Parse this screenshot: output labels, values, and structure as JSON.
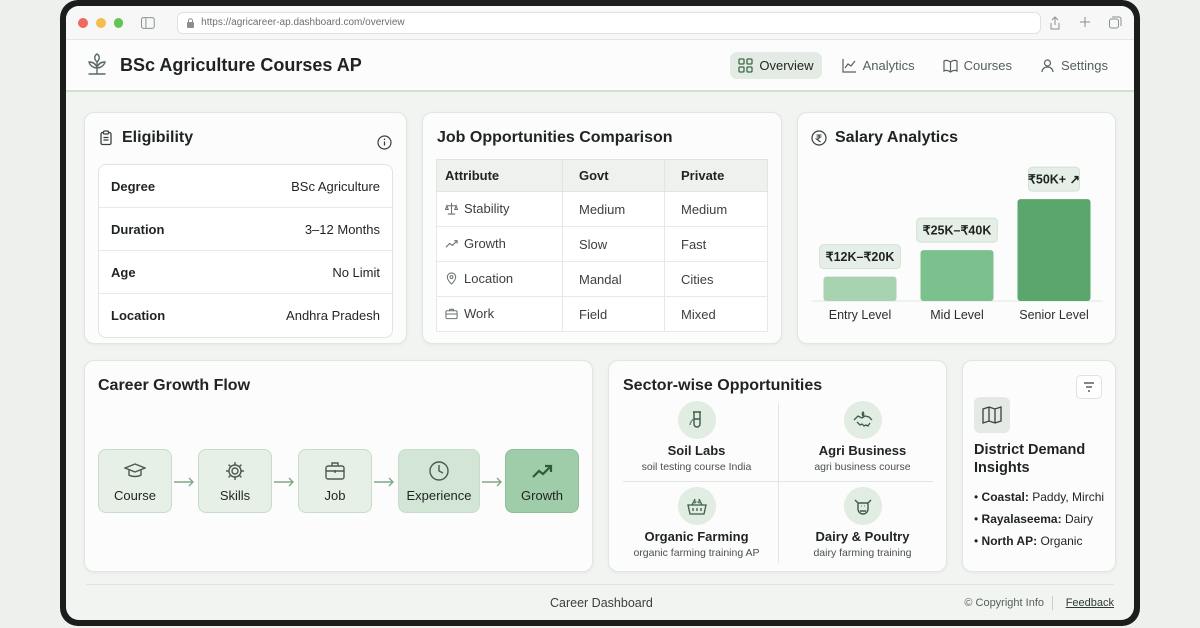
{
  "browser": {
    "url": "https://agricareer-ap.dashboard.com/overview",
    "dots": [
      "#ee6a5f",
      "#f5bd4f",
      "#61c454"
    ]
  },
  "header": {
    "title": "BSc Agriculture Courses AP",
    "nav": [
      {
        "label": "Overview",
        "icon": "grid-icon",
        "active": true
      },
      {
        "label": "Analytics",
        "icon": "line-chart-icon",
        "active": false
      },
      {
        "label": "Courses",
        "icon": "book-icon",
        "active": false
      },
      {
        "label": "Settings",
        "icon": "user-icon",
        "active": false
      }
    ]
  },
  "eligibility": {
    "title": "Eligibility",
    "rows": [
      {
        "key": "Degree",
        "value": "BSc Agriculture"
      },
      {
        "key": "Duration",
        "value": "3–12 Months"
      },
      {
        "key": "Age",
        "value": "No Limit"
      },
      {
        "key": "Location",
        "value": "Andhra Pradesh"
      }
    ]
  },
  "jobs": {
    "title": "Job Opportunities Comparison",
    "headers": [
      "Attribute",
      "Govt",
      "Private"
    ],
    "rows": [
      {
        "icon": "scale-icon",
        "attribute": "Stability",
        "govt": "Medium",
        "private": "Medium"
      },
      {
        "icon": "trend-icon",
        "attribute": "Growth",
        "govt": "Slow",
        "private": "Fast"
      },
      {
        "icon": "location-pin-icon",
        "attribute": "Location",
        "govt": "Mandal",
        "private": "Cities"
      },
      {
        "icon": "briefcase-icon",
        "attribute": "Work",
        "govt": "Field",
        "private": "Mixed"
      }
    ]
  },
  "salary": {
    "title": "Salary Analytics"
  },
  "chart_data": {
    "type": "bar",
    "categories": [
      "Entry Level",
      "Mid Level",
      "Senior Level"
    ],
    "values": [
      12,
      25,
      50
    ],
    "data_labels": [
      "₹12K–₹20K",
      "₹25K–₹40K",
      "₹50K+"
    ],
    "colors": [
      "#a8d3b1",
      "#7cc08d",
      "#5aa66c"
    ],
    "ylim": [
      0,
      55
    ],
    "grid": false,
    "legend": "none"
  },
  "flow": {
    "title": "Career Growth Flow",
    "steps": [
      {
        "label": "Course",
        "icon": "graduation-cap-icon"
      },
      {
        "label": "Skills",
        "icon": "gear-icon"
      },
      {
        "label": "Job",
        "icon": "briefcase-icon"
      },
      {
        "label": "Experience",
        "icon": "clock-icon"
      },
      {
        "label": "Growth",
        "icon": "trend-up-icon"
      }
    ]
  },
  "sectors": {
    "title": "Sector-wise Opportunities",
    "items": [
      {
        "name": "Soil Labs",
        "sub": "soil testing course India",
        "icon": "test-tube-icon"
      },
      {
        "name": "Agri Business",
        "sub": "agri business course",
        "icon": "handshake-icon"
      },
      {
        "name": "Organic Farming",
        "sub": "organic farming training AP",
        "icon": "basket-icon"
      },
      {
        "name": "Dairy & Poultry",
        "sub": "dairy farming training",
        "icon": "cow-icon"
      }
    ]
  },
  "district": {
    "title": "District Demand Insights",
    "items": [
      {
        "region": "Coastal:",
        "crops": "Paddy, Mirchi"
      },
      {
        "region": "Rayalaseema:",
        "crops": "Dairy"
      },
      {
        "region": "North AP:",
        "crops": "Organic"
      }
    ]
  },
  "footer": {
    "center": "Career Dashboard",
    "copyright": "© Copyright Info",
    "feedback": "Feedback"
  }
}
